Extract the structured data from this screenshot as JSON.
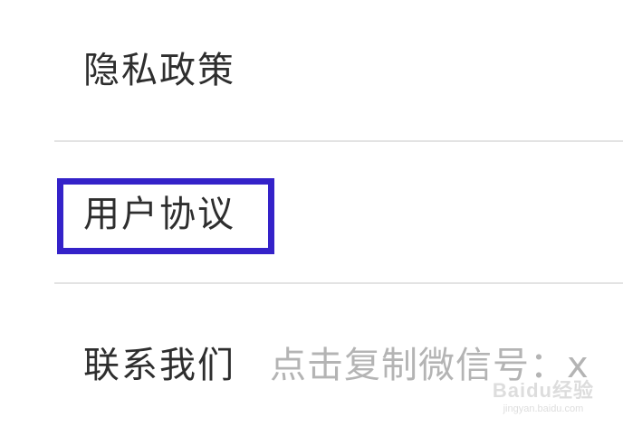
{
  "menu": {
    "items": [
      {
        "label": "隐私政策"
      },
      {
        "label": "用户协议"
      },
      {
        "label": "联系我们",
        "hint": "点击复制微信号：x"
      }
    ]
  },
  "highlight": {
    "color": "#3422c9",
    "target": "用户协议"
  },
  "watermark": {
    "logo": "Baidu经验",
    "url": "jingyan.baidu.com"
  }
}
